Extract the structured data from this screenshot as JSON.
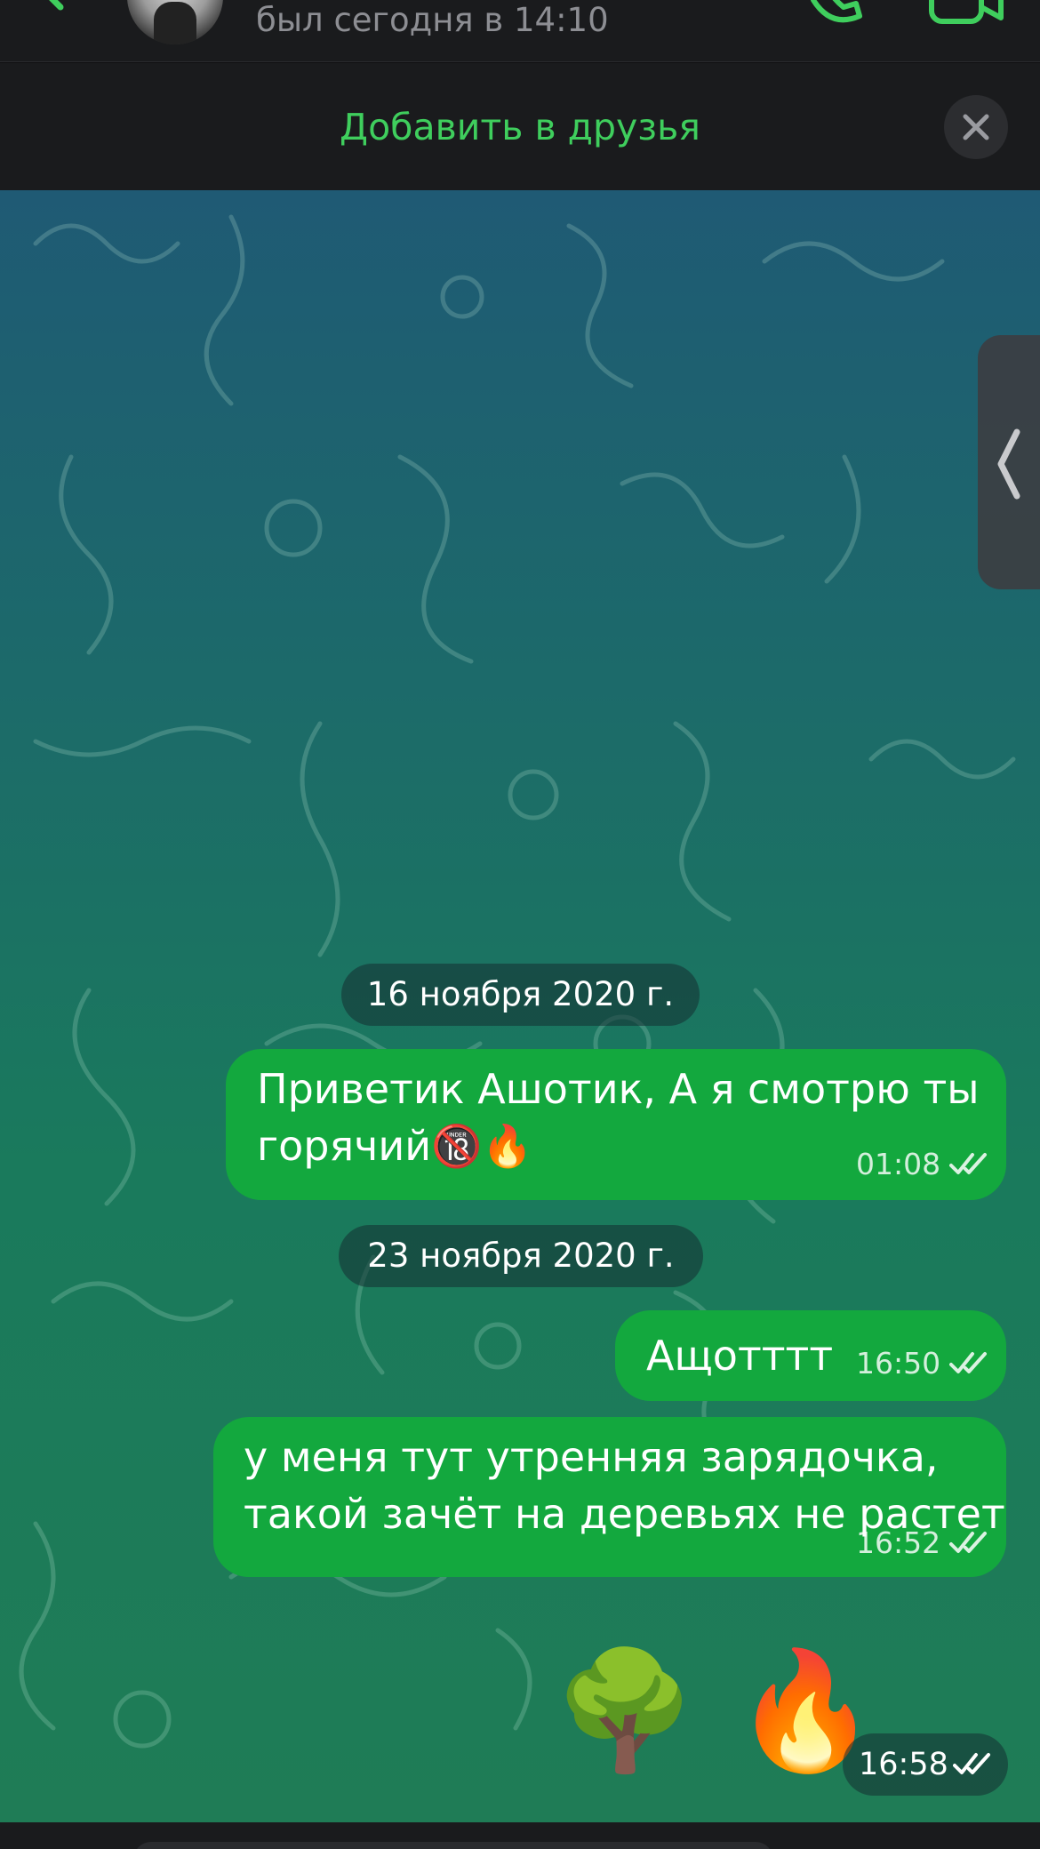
{
  "header": {
    "last_seen": "был сегодня в 14:10"
  },
  "add_friend": {
    "label": "Добавить в друзья"
  },
  "messages": [
    {
      "kind": "date",
      "label": "16 ноября 2020 г."
    },
    {
      "kind": "outgoing",
      "line1": "Приветик Ашотик, А я смотрю ты",
      "line2": "горячий🔞🔥",
      "time": "01:08",
      "status": "read"
    },
    {
      "kind": "date",
      "label": "23 ноября 2020 г."
    },
    {
      "kind": "outgoing",
      "line1": "Ащотттт",
      "time": "16:50",
      "status": "read"
    },
    {
      "kind": "outgoing",
      "line1": "у меня тут утренняя зарядочка,",
      "line2": "такой зачёт на деревьях не растет",
      "time": "16:52",
      "status": "read"
    },
    {
      "kind": "outgoing-emoji",
      "emoji": "🌳 🔥",
      "time": "16:58",
      "status": "read"
    }
  ],
  "colors": {
    "accent": "#3fce5d",
    "bubble": "#13a83e",
    "header_bg": "#1a1b1d"
  },
  "icons": [
    "back-chevron-icon",
    "phone-icon",
    "video-camera-icon",
    "close-icon",
    "chevron-left-icon",
    "double-check-icon"
  ]
}
